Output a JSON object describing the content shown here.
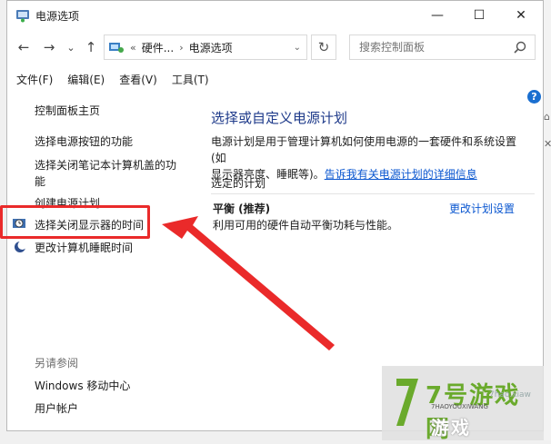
{
  "window": {
    "title": "电源选项",
    "controls": {
      "minimize": "—",
      "maximize": "☐",
      "close": "✕"
    }
  },
  "nav": {
    "back": "←",
    "forward": "→",
    "recent": "⌄",
    "up": "↑",
    "breadcrumb": {
      "chevrons": "«",
      "parent": "硬件...",
      "sep": "›",
      "current": "电源选项"
    },
    "refresh": "↻",
    "search_placeholder": "搜索控制面板"
  },
  "menu": [
    "文件(F)",
    "编辑(E)",
    "查看(V)",
    "工具(T)"
  ],
  "help": "?",
  "left_nav": {
    "home": "控制面板主页",
    "items": [
      "选择电源按钮的功能",
      "选择关闭笔记本计算机盖的功",
      "能",
      "创建电源计划",
      "选择关闭显示器的时间",
      "更改计算机睡眠时间"
    ],
    "see_also": "另请参阅",
    "see_also_links": [
      "Windows 移动中心",
      "用户帐户"
    ]
  },
  "main": {
    "title": "选择或自定义电源计划",
    "desc_line1": "电源计划是用于管理计算机如何使用电源的一套硬件和系统设置(如",
    "desc_line2_prefix": "显示器亮度、睡眠等)。",
    "desc_link": "告诉我有关电源计划的详细信息",
    "selected_plan_label": "选定的计划",
    "plan_name": "平衡 (推荐)",
    "plan_desc": "利用可用的硬件自动平衡功耗与性能。",
    "plan_change_link": "更改计划设置"
  },
  "watermark": {
    "big": "7号游戏网",
    "small": "游戏",
    "url": "7hao.xiaw",
    "url2": "7HAOYOUXIWANG"
  },
  "colors": {
    "annotation": "#ea2a2a",
    "link": "#0b57d0",
    "title": "#1e3a8a"
  }
}
